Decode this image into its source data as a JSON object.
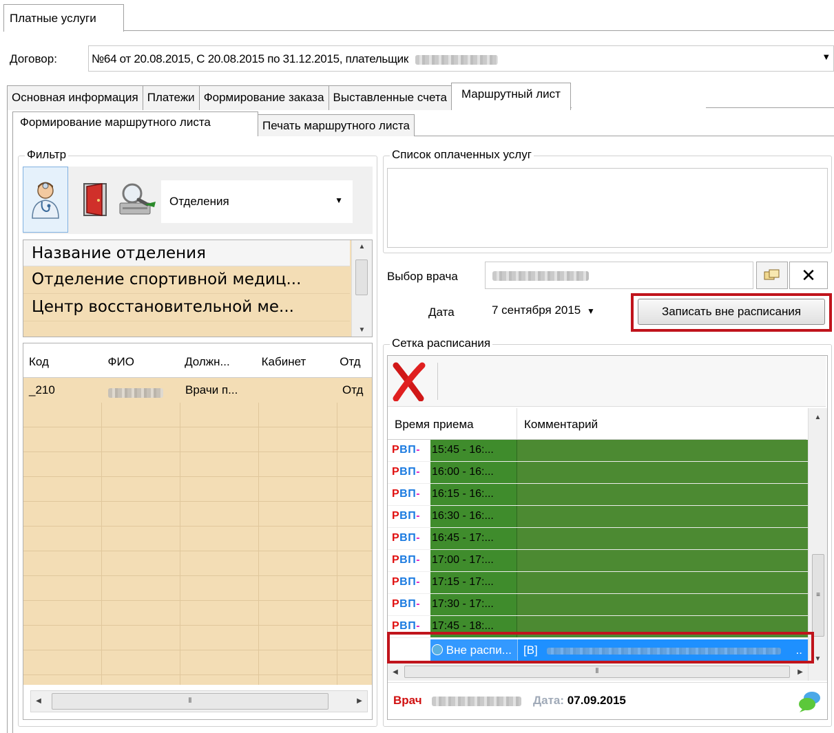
{
  "window_tab": "Платные услуги",
  "contract": {
    "label": "Договор:",
    "value": "№64 от 20.08.2015, С 20.08.2015 по 31.12.2015, плательщик"
  },
  "tabs": [
    "Основная информация",
    "Платежи",
    "Формирование заказа",
    "Выставленные счета",
    "Маршрутный лист"
  ],
  "subtabs": [
    "Формирование маршрутного листа",
    "Печать маршрутного листа"
  ],
  "filter": {
    "title": "Фильтр",
    "icons": [
      "doctor-icon",
      "door-icon",
      "search-magnifier-icon"
    ],
    "select_value": "Отделения"
  },
  "departments": {
    "header": "Название отделения",
    "rows": [
      "Отделение спортивной медиц...",
      "Центр восстановительной ме..."
    ]
  },
  "doctors": {
    "columns": [
      "Код",
      "ФИО",
      "Должн...",
      "Кабинет",
      "Отд"
    ],
    "rows": [
      {
        "code": "_210",
        "position": "Врачи п...",
        "room": "",
        "dept": "Отд"
      }
    ]
  },
  "paid_services": {
    "title": "Список оплаченных услуг"
  },
  "doctor_choice": {
    "label": "Выбор врача"
  },
  "date": {
    "label": "Дата",
    "value": "7 сентября 2015",
    "button": "Записать вне расписания"
  },
  "schedule": {
    "title": "Сетка расписания",
    "columns": [
      "Время приема",
      "Комментарий"
    ],
    "tag": "РВП",
    "slots": [
      "15:45 - 16:...",
      "16:00 - 16:...",
      "16:15 - 16:...",
      "16:30 - 16:...",
      "16:45 - 17:...",
      "17:00 - 17:...",
      "17:15 - 17:...",
      "17:30 - 17:...",
      "17:45 - 18:..."
    ],
    "special_row": {
      "time": "Вне распи...",
      "comment": "[В]",
      "ellipsis": ".."
    },
    "footer": {
      "doctor_label": "Врач",
      "date_label": "Дата:",
      "date_value": "07.09.2015"
    }
  },
  "colors": {
    "slot_green": "#3f8c2c",
    "row_tan": "#f3ddb5",
    "highlight_red": "#c0141c",
    "selection_blue": "#3399ff"
  }
}
